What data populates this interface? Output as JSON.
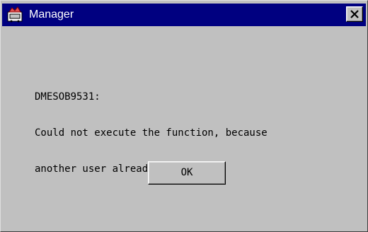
{
  "window": {
    "title": "Manager",
    "app_icon": "manager-app-icon",
    "close_icon": "close-x-icon",
    "colors": {
      "titlebar": "#000080",
      "face": "#c0c0c0",
      "title_text": "#ffffff"
    }
  },
  "dialog": {
    "message_lines": [
      "DMESOB9531:",
      "Could not execute the function, because",
      "another user already logged in."
    ],
    "ok_label": "OK"
  }
}
